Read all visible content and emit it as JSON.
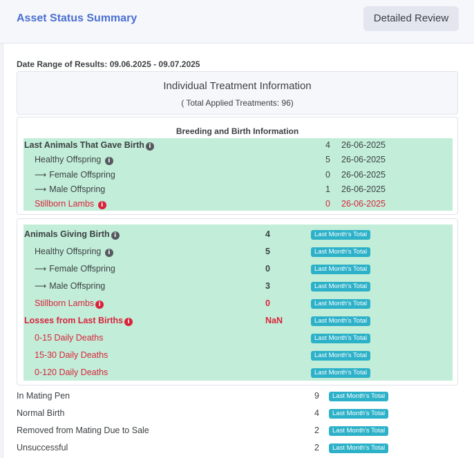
{
  "header": {
    "title": "Asset Status Summary",
    "button_label": "Detailed Review"
  },
  "date_range": "Date Range of Results: 09.06.2025 - 09.07.2025",
  "treatment": {
    "title": "Individual Treatment Information",
    "total": "( Total Applied Treatments: 96)"
  },
  "breeding": {
    "heading": "Breeding and Birth Information",
    "rows": [
      {
        "label": "Last Animals That Gave Birth",
        "count": "4",
        "date": "26-06-2025"
      },
      {
        "label": "Healthy Offspring",
        "count": "5",
        "date": "26-06-2025"
      },
      {
        "label": "Female Offspring",
        "count": "0",
        "date": "26-06-2025"
      },
      {
        "label": "Male Offspring",
        "count": "1",
        "date": "26-06-2025"
      },
      {
        "label": "Stillborn Lambs",
        "count": "0",
        "date": "26-06-2025"
      }
    ]
  },
  "monthly": {
    "badge": "Last Month's Total",
    "rows": [
      {
        "label": "Animals Giving Birth",
        "count": "4"
      },
      {
        "label": "Healthy Offspring",
        "count": "5"
      },
      {
        "label": "Female Offspring",
        "count": "0"
      },
      {
        "label": "Male Offspring",
        "count": "3"
      },
      {
        "label": "Stillborn Lambs",
        "count": "0"
      },
      {
        "label": "Losses from Last Births",
        "count": "NaN"
      },
      {
        "label": "0-15 Daily Deaths",
        "count": ""
      },
      {
        "label": "15-30 Daily Deaths",
        "count": ""
      },
      {
        "label": "0-120 Daily Deaths",
        "count": ""
      }
    ]
  },
  "bottom": {
    "rows": [
      {
        "label": "In Mating Pen",
        "count": "9"
      },
      {
        "label": "Normal Birth",
        "count": "4"
      },
      {
        "label": "Removed from Mating Due to Sale",
        "count": "2"
      },
      {
        "label": "Unsuccessful",
        "count": "2"
      }
    ]
  },
  "icons": {
    "info": "info-icon",
    "arrow": "arrow-right-icon"
  },
  "colors": {
    "accent": "#4a6fd1",
    "green_bg": "#c2eed9",
    "red": "#d8233a",
    "badge": "#2cb1c9"
  }
}
